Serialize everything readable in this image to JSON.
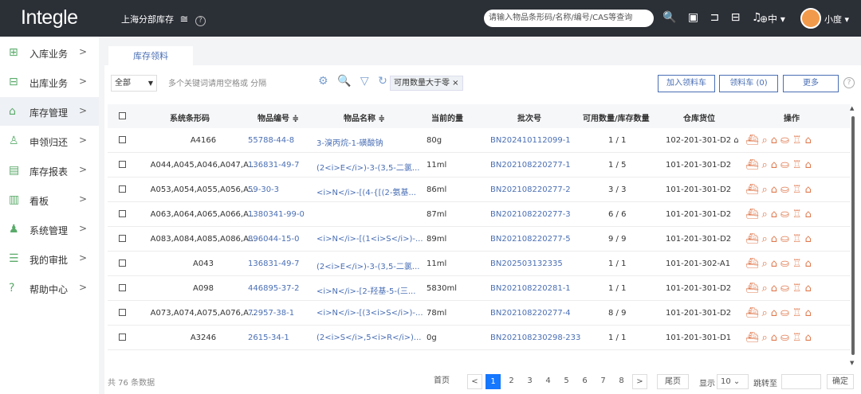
{
  "header": {
    "logo": "Integle",
    "location": "上海分部库存",
    "filter_glyph": "≅",
    "help_glyph": "?",
    "search_placeholder": "请输入物品条形码/名称/编号/CAS等查询",
    "icons": [
      "search-icon",
      "scan-icon",
      "tag-icon",
      "print-icon",
      "bell-icon"
    ],
    "icon_glyphs": [
      "🔍",
      "▣",
      "⊐",
      "⊟",
      "♫"
    ],
    "lang": "⊕中 ▾",
    "user": "小度 ▾"
  },
  "sidebar": {
    "items": [
      {
        "label": "入库业务",
        "icon": "inbound-icon",
        "glyph": "⊞",
        "arrow": ">"
      },
      {
        "label": "出库业务",
        "icon": "outbound-icon",
        "glyph": "⊟",
        "arrow": ">"
      },
      {
        "label": "库存管理",
        "icon": "inventory-icon",
        "glyph": "⌂",
        "arrow": ">"
      },
      {
        "label": "申领归还",
        "icon": "claim-icon",
        "glyph": "♙",
        "arrow": ">"
      },
      {
        "label": "库存报表",
        "icon": "report-icon",
        "glyph": "▤",
        "arrow": ">"
      },
      {
        "label": "看板",
        "icon": "dashboard-icon",
        "glyph": "▥",
        "arrow": ">"
      },
      {
        "label": "系统管理",
        "icon": "system-icon",
        "glyph": "♟",
        "arrow": ">"
      },
      {
        "label": "我的审批",
        "icon": "approval-icon",
        "glyph": "☰",
        "arrow": ">"
      },
      {
        "label": "帮助中心",
        "icon": "help-center-icon",
        "glyph": "?",
        "arrow": ">"
      }
    ]
  },
  "tabs": [
    {
      "label": "库存领料"
    }
  ],
  "toolbar": {
    "scope": "全部",
    "keyword_placeholder": "多个关键词请用空格或 分隔",
    "tool_glyphs": [
      "⚙",
      "🔍",
      "▽",
      "↻"
    ],
    "chip": "可用数量大于零 ×",
    "add_cart": "加入领料车",
    "cart": "领料车 (0)",
    "more": "更多",
    "help": "?"
  },
  "table": {
    "headers": [
      "系统条形码",
      "物品编号 ≑",
      "物品名称 ≑",
      "当前的量",
      "批次号",
      "可用数量/库存数量",
      "仓库货位",
      "操作"
    ],
    "op_glyphs": "⛴⌕⌂⛀♖⌂",
    "rows": [
      {
        "barcode": "A4166",
        "item_no": "55788-44-8",
        "name": "3-溴丙烷-1-磺酸钠",
        "qty": "80g",
        "batch": "BN202410112099-1",
        "avail": "1 / 1",
        "location": "102-201-301-D2 ⌂"
      },
      {
        "barcode": "A044,A045,A046,A047,A...",
        "item_no": "136831-49-7",
        "name": "(2<i>E</i>)-3-(3,5-二氯...",
        "qty": "11ml",
        "batch": "BN202108220277-1",
        "avail": "1 / 5",
        "location": "101-201-301-D2"
      },
      {
        "barcode": "A053,A054,A055,A056,A...",
        "item_no": "59-30-3",
        "name": "<i>N</i>-[(4-{[(2-氨基...",
        "qty": "86ml",
        "batch": "BN202108220277-2",
        "avail": "3 / 3",
        "location": "101-201-301-D2"
      },
      {
        "barcode": "A063,A064,A065,A066,A...",
        "item_no": "1380341-99-0",
        "name": "",
        "qty": "87ml",
        "batch": "BN202108220277-3",
        "avail": "6 / 6",
        "location": "101-201-301-D2"
      },
      {
        "barcode": "A083,A084,A085,A086,A...",
        "item_no": "896044-15-0",
        "name": "<i>N</i>-[(1<i>S</i>)-...",
        "qty": "89ml",
        "batch": "BN202108220277-5",
        "avail": "9 / 9",
        "location": "101-201-301-D2"
      },
      {
        "barcode": "A043",
        "item_no": "136831-49-7",
        "name": "(2<i>E</i>)-3-(3,5-二氯...",
        "qty": "11ml",
        "batch": "BN202503132335",
        "avail": "1 / 1",
        "location": "101-201-302-A1"
      },
      {
        "barcode": "A098",
        "item_no": "446895-37-2",
        "name": "<i>N</i>-[2-羟基-5-(三...",
        "qty": "5830ml",
        "batch": "BN202108220281-1",
        "avail": "1 / 1",
        "location": "101-201-301-D2"
      },
      {
        "barcode": "A073,A074,A075,A076,A...",
        "item_no": "72957-38-1",
        "name": "<i>N</i>-[(3<i>S</i>)-...",
        "qty": "78ml",
        "batch": "BN202108220277-4",
        "avail": "8 / 9",
        "location": "101-201-301-D2"
      },
      {
        "barcode": "A3246",
        "item_no": "2615-34-1",
        "name": "(2<i>S</i>,5<i>R</i>)...",
        "qty": "0g",
        "batch": "BN202108230298-233",
        "avail": "1 / 1",
        "location": "101-201-301-D1"
      }
    ]
  },
  "footer": {
    "total": "共 76 条数据",
    "first": "首页",
    "prev": "<",
    "pages": [
      "1",
      "2",
      "3",
      "4",
      "5",
      "6",
      "7",
      "8"
    ],
    "current": "1",
    "next": ">",
    "last": "尾页",
    "show": "显示",
    "per_page": "10 ⌄",
    "goto": "跳转至",
    "confirm": "确定"
  }
}
